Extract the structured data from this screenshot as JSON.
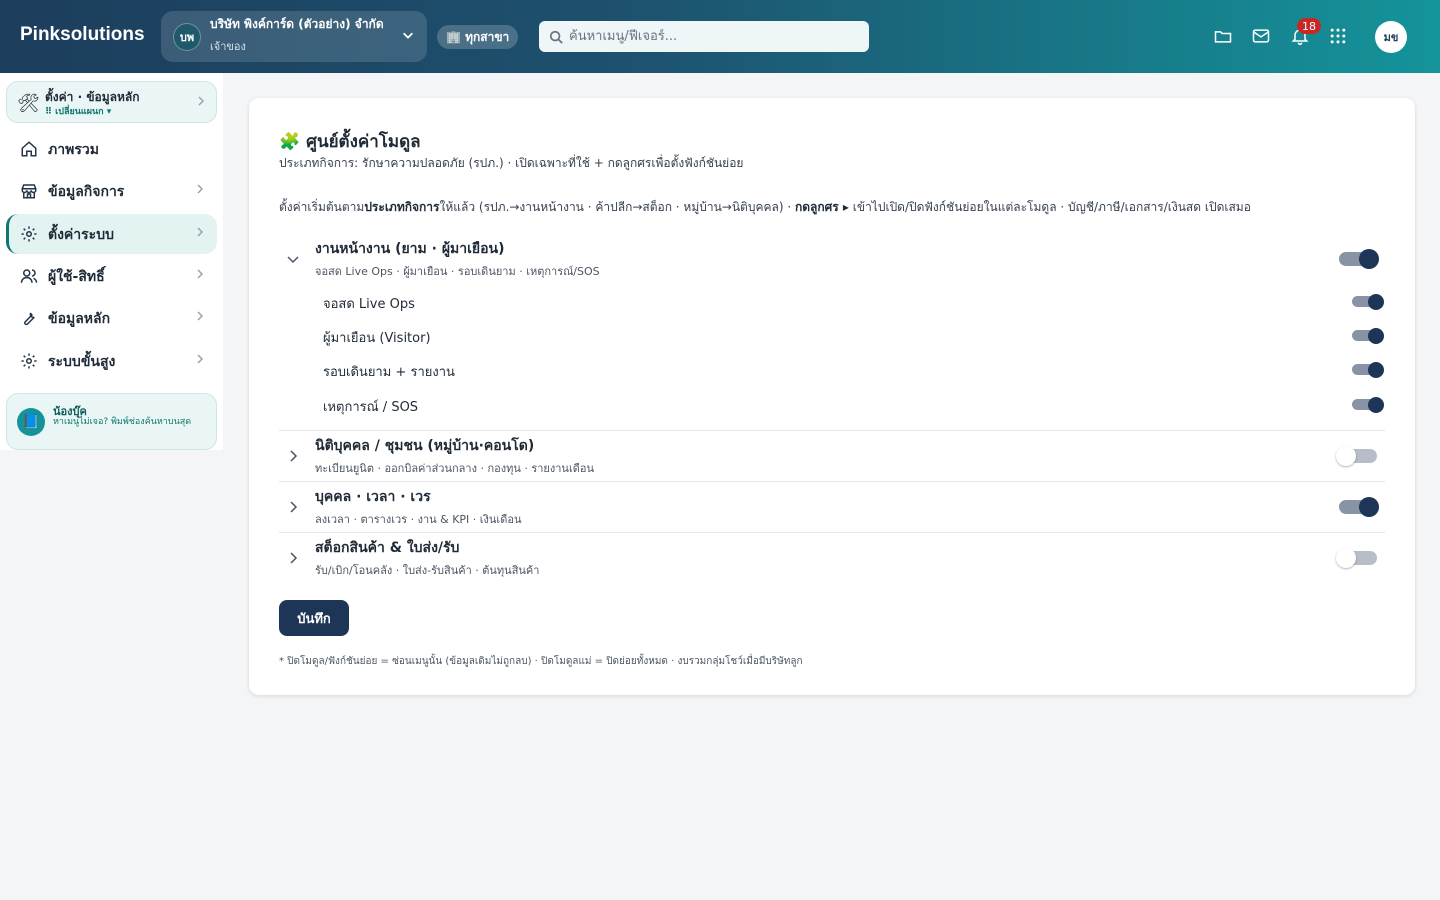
{
  "app": {
    "brand": "Pinksolutions"
  },
  "company": {
    "initials": "บพ",
    "name": "บริษัท พิงค์การ์ด (ตัวอย่าง) จำกัด",
    "role": "เจ้าของ"
  },
  "branch": {
    "label": "🏢 ทุกสาขา"
  },
  "search": {
    "placeholder": "ค้นหาเมนู/ฟีเจอร์..."
  },
  "notifications": {
    "count": "18"
  },
  "user": {
    "initials": "มข"
  },
  "sidebar": {
    "header": {
      "title": "ตั้งค่า · ข้อมูลหลัก",
      "subtitle": "⠿ เปลี่ยนแผนก ▾"
    },
    "items": [
      {
        "label": "ภาพรวม",
        "icon": "home-icon"
      },
      {
        "label": "ข้อมูลกิจการ",
        "icon": "store-icon"
      },
      {
        "label": "ตั้งค่าระบบ",
        "icon": "gear-icon",
        "active": true
      },
      {
        "label": "ผู้ใช้-สิทธิ์",
        "icon": "users-icon"
      },
      {
        "label": "ข้อมูลหลัก",
        "icon": "wrench-icon"
      },
      {
        "label": "ระบบขั้นสูง",
        "icon": "gear-icon"
      }
    ],
    "help": {
      "title": "น้องบุ๊ค",
      "text": "หาเมนูไม่เจอ? พิมพ์ช่องค้นหาบนสุด"
    }
  },
  "main": {
    "title": "ศูนย์ตั้งค่าโมดูล",
    "subtitle": "ประเภทกิจการ: รักษาความปลอดภัย (รปภ.) · เปิดเฉพาะที่ใช้ + กดลูกศรเพื่อตั้งฟังก์ชันย่อย",
    "desc_1": "ตั้งค่าเริ่มต้นตาม",
    "desc_bold_1": "ประเภทกิจการ",
    "desc_2": "ให้แล้ว (รปภ.→งานหน้างาน · ค้าปลีก→สต็อก · หมู่บ้าน→นิติบุคคล) · ",
    "desc_bold_2": "กดลูกศร ▸",
    "desc_3": " เข้าไปเปิด/ปิดฟังก์ชันย่อยในแต่ละโมดูล · บัญชี/ภาษี/เอกสาร/เงินสด เปิดเสมอ",
    "modules": [
      {
        "title": "งานหน้างาน (ยาม · ผู้มาเยือน)",
        "subtitle": "จอสด Live Ops · ผู้มาเยือน · รอบเดินยาม · เหตุการณ์/SOS",
        "enabled": true,
        "expanded": true,
        "subs": [
          {
            "label": "จอสด Live Ops",
            "enabled": true
          },
          {
            "label": "ผู้มาเยือน (Visitor)",
            "enabled": true
          },
          {
            "label": "รอบเดินยาม + รายงาน",
            "enabled": true
          },
          {
            "label": "เหตุการณ์ / SOS",
            "enabled": true
          }
        ]
      },
      {
        "title": "นิติบุคคล / ชุมชน (หมู่บ้าน·คอนโด)",
        "subtitle": "ทะเบียนยูนิต · ออกบิลค่าส่วนกลาง · กองทุน · รายงานเดือน",
        "enabled": false,
        "expanded": false
      },
      {
        "title": "บุคคล · เวลา · เวร",
        "subtitle": "ลงเวลา · ตารางเวร · งาน & KPI · เงินเดือน",
        "enabled": true,
        "expanded": false
      },
      {
        "title": "สต็อกสินค้า & ใบส่ง/รับ",
        "subtitle": "รับ/เบิก/โอนคลัง · ใบส่ง-รับสินค้า · ต้นทุนสินค้า",
        "enabled": false,
        "expanded": false
      }
    ],
    "save_label": "บันทึก",
    "footnote": "* ปิดโมดูล/ฟังก์ชันย่อย = ซ่อนเมนูนั้น (ข้อมูลเดิมไม่ถูกลบ) · ปิดโมดูลแม่ = ปิดย่อยทั้งหมด · งบรวมกลุ่มโชว์เมื่อมีบริษัทลูก"
  }
}
